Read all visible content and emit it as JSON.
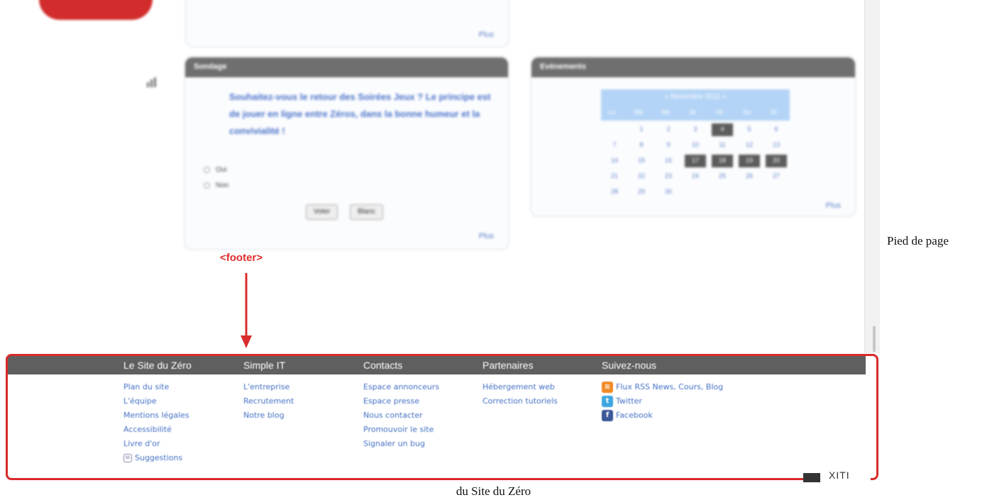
{
  "poll": {
    "title": "Sondage",
    "question": "Souhaitez-vous le retour des Soirées Jeux ? Le principe est de jouer en ligne entre Zéros, dans la bonne humeur et la convivialité !",
    "options": [
      "Oui",
      "Non"
    ],
    "vote_label": "Voter",
    "results_label": "Blanc",
    "more_label": "Plus"
  },
  "top_box": {
    "more_label": "Plus"
  },
  "events": {
    "title": "Evènements",
    "month": "« Novembre 2011 »",
    "weekdays": [
      "Lu",
      "Ma",
      "Me",
      "Je",
      "Ve",
      "Sa",
      "Di"
    ],
    "days": [
      [
        "",
        "1",
        "2",
        "3",
        "4",
        "5",
        "6"
      ],
      [
        "7",
        "8",
        "9",
        "10",
        "11",
        "12",
        "13"
      ],
      [
        "14",
        "15",
        "16",
        "17",
        "18",
        "19",
        "20"
      ],
      [
        "21",
        "22",
        "23",
        "24",
        "25",
        "26",
        "27"
      ],
      [
        "28",
        "29",
        "30",
        "",
        "",
        "",
        ""
      ]
    ],
    "highlighted": [
      "4",
      "17",
      "18",
      "19",
      "20"
    ],
    "more_label": "Plus"
  },
  "annotation": {
    "label": "<footer>",
    "color": "#e02d2d"
  },
  "footer": {
    "columns": [
      {
        "title": "Le Site du Zéro",
        "links": [
          "Plan du site",
          "L'équipe",
          "Mentions légales",
          "Accessibilité",
          "Livre d'or",
          "Suggestions"
        ]
      },
      {
        "title": "Simple IT",
        "links": [
          "L'entreprise",
          "Recrutement",
          "Notre blog"
        ]
      },
      {
        "title": "Contacts",
        "links": [
          "Espace annonceurs",
          "Espace presse",
          "Nous contacter",
          "Promouvoir le site",
          "Signaler un bug"
        ]
      },
      {
        "title": "Partenaires",
        "links": [
          "Hébergement web",
          "Correction tutoriels"
        ]
      },
      {
        "title": "Suivez-nous",
        "links": [
          "Flux RSS News, Cours, Blog",
          "Twitter",
          "Facebook"
        ]
      }
    ],
    "social_icons": [
      "rss-icon",
      "twitter-icon",
      "facebook-icon"
    ],
    "xiti_label": "XITI"
  },
  "captions": {
    "right": "Pied de page",
    "bottom": "du Site du Zéro"
  },
  "colors": {
    "frame": "#d92a2a",
    "link": "#4470c4",
    "header_bar": "#5f5f5f"
  }
}
